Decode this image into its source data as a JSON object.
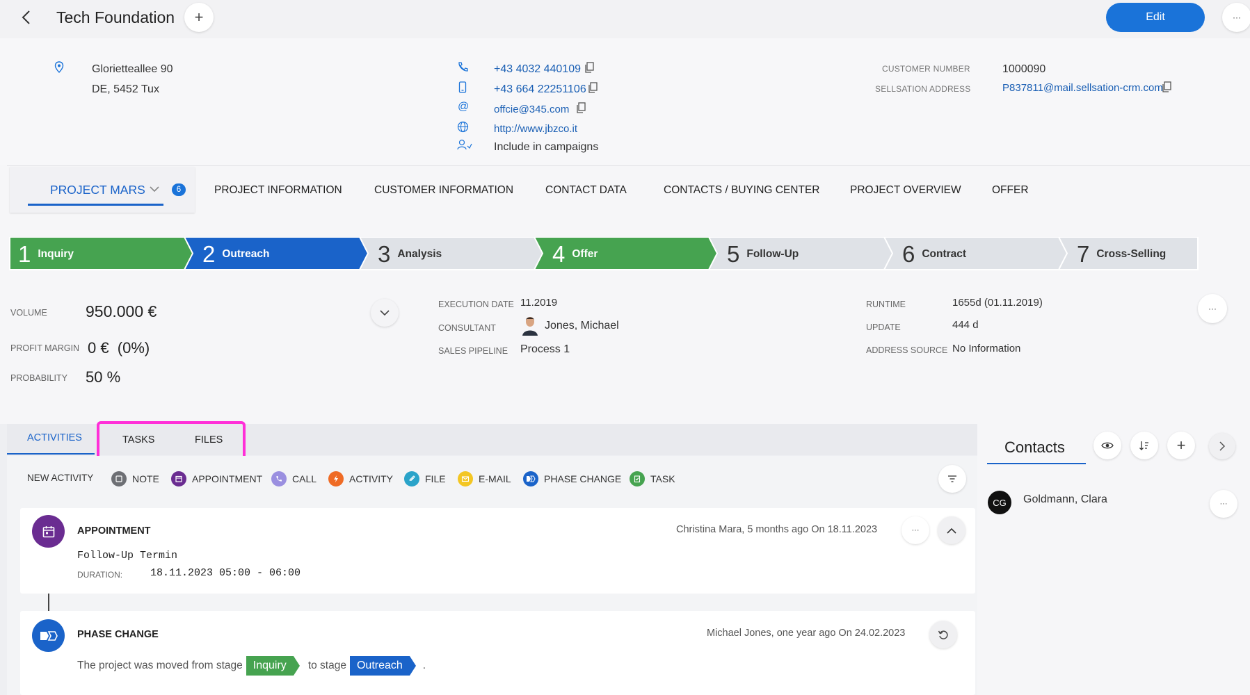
{
  "header": {
    "title": "Tech Foundation",
    "edit_label": "Edit",
    "more_label": "···"
  },
  "address": {
    "line1": "Glorietteallee 90",
    "line2": "DE, 5452 Tux"
  },
  "contact": {
    "phone": "+43 4032 440109",
    "mobile": "+43 664 22251106",
    "email": "offcie@345.com",
    "website": "http://www.jbzco.it",
    "campaigns": "Include in campaigns"
  },
  "customer": {
    "number_label": "CUSTOMER NUMBER",
    "number": "1000090",
    "sellsation_label": "SELLSATION ADDRESS",
    "sellsation": "P837811@mail.sellsation-crm.com"
  },
  "project_tabs": {
    "current": "PROJECT MARS",
    "count": "6",
    "items": [
      "PROJECT INFORMATION",
      "CUSTOMER INFORMATION",
      "CONTACT DATA",
      "CONTACTS / BUYING CENTER",
      "PROJECT OVERVIEW",
      "OFFER"
    ]
  },
  "stages": [
    {
      "num": "1",
      "label": "Inquiry",
      "color": "#46a350"
    },
    {
      "num": "2",
      "label": "Outreach",
      "color": "#1a63c9"
    },
    {
      "num": "3",
      "label": "Analysis",
      "color": "#dfe2e7"
    },
    {
      "num": "4",
      "label": "Offer",
      "color": "#46a350"
    },
    {
      "num": "5",
      "label": "Follow-Up",
      "color": "#dfe2e7"
    },
    {
      "num": "6",
      "label": "Contract",
      "color": "#dfe2e7"
    },
    {
      "num": "7",
      "label": "Cross-Selling",
      "color": "#dfe2e7"
    }
  ],
  "metrics": {
    "volume_label": "VOLUME",
    "volume": "950.000 €",
    "margin_label": "PROFIT MARGIN",
    "margin": "0 €  (0%)",
    "probability_label": "PROBABILITY",
    "probability": "50 %"
  },
  "details": {
    "execution_label": "EXECUTION DATE",
    "execution": "11.2019",
    "consultant_label": "CONSULTANT",
    "consultant": "Jones, Michael",
    "pipeline_label": "SALES PIPELINE",
    "pipeline": "Process 1",
    "runtime_label": "RUNTIME",
    "runtime": "1655d (01.11.2019)",
    "update_label": "UPDATE",
    "update": "444 d",
    "source_label": "ADDRESS SOURCE",
    "source": "No Information"
  },
  "activity_tabs": {
    "activities": "ACTIVITIES",
    "tasks": "TASKS",
    "files": "FILES"
  },
  "new_activity": {
    "label": "NEW ACTIVITY",
    "items": [
      "NOTE",
      "APPOINTMENT",
      "CALL",
      "ACTIVITY",
      "FILE",
      "E-MAIL",
      "PHASE CHANGE",
      "TASK"
    ]
  },
  "timeline": {
    "appointment": {
      "title": "APPOINTMENT",
      "meta": "Christina Mara, 5 months ago On 18.11.2023",
      "subject": "Follow-Up Termin",
      "duration_label": "DURATION:",
      "duration": "18.11.2023 05:00 - 06:00"
    },
    "phase": {
      "title": "PHASE CHANGE",
      "meta": "Michael Jones, one year ago On 24.02.2023",
      "text_before": "The project was moved from stage",
      "from": "Inquiry",
      "text_mid": "to stage",
      "to": "Outreach",
      "text_end": "."
    }
  },
  "contacts_panel": {
    "title": "Contacts",
    "person_initials": "CG",
    "person_name": "Goldmann, Clara"
  },
  "colors": {
    "accent": "#1a73d9",
    "green": "#46a350",
    "blue": "#1a63c9",
    "highlight": "#ff2fd8"
  }
}
